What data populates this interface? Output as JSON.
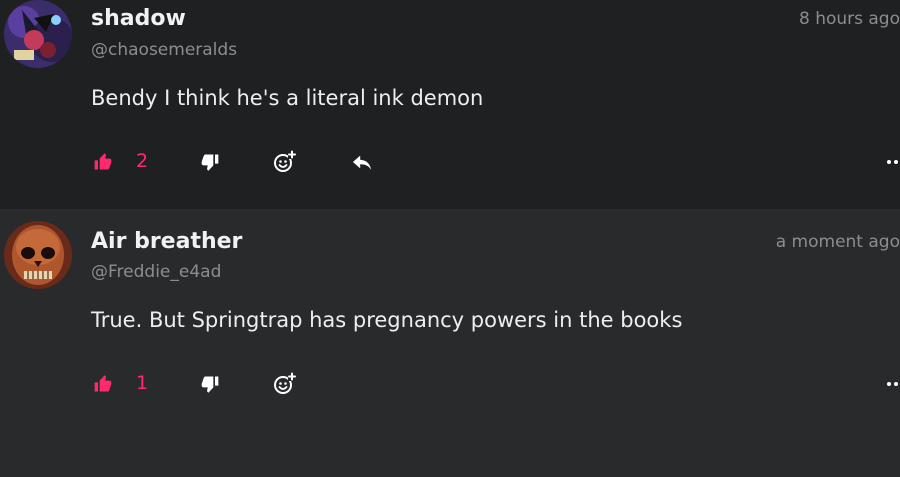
{
  "comments": [
    {
      "username": "shadow",
      "handle": "@chaosemeralds",
      "time": "8 hours ago",
      "text": "Bendy I think he's a literal ink demon",
      "likes": "2",
      "has_reply": true
    },
    {
      "username": "Air breather",
      "handle": "@Freddie_e4ad",
      "time": "a moment ago",
      "text": "True. But Springtrap has pregnancy powers in the books",
      "likes": "1",
      "has_reply": false
    }
  ],
  "colors": {
    "accent": "#ff2a6d",
    "text": "#f2f2f2",
    "muted": "#8b8d8f",
    "background_1": "#1f2021",
    "background_2": "#292a2b"
  },
  "icons": {
    "like": "thumbs-up-icon",
    "dislike": "thumbs-down-icon",
    "react": "add-emoji-icon",
    "reply": "reply-icon",
    "more": "more-icon"
  }
}
